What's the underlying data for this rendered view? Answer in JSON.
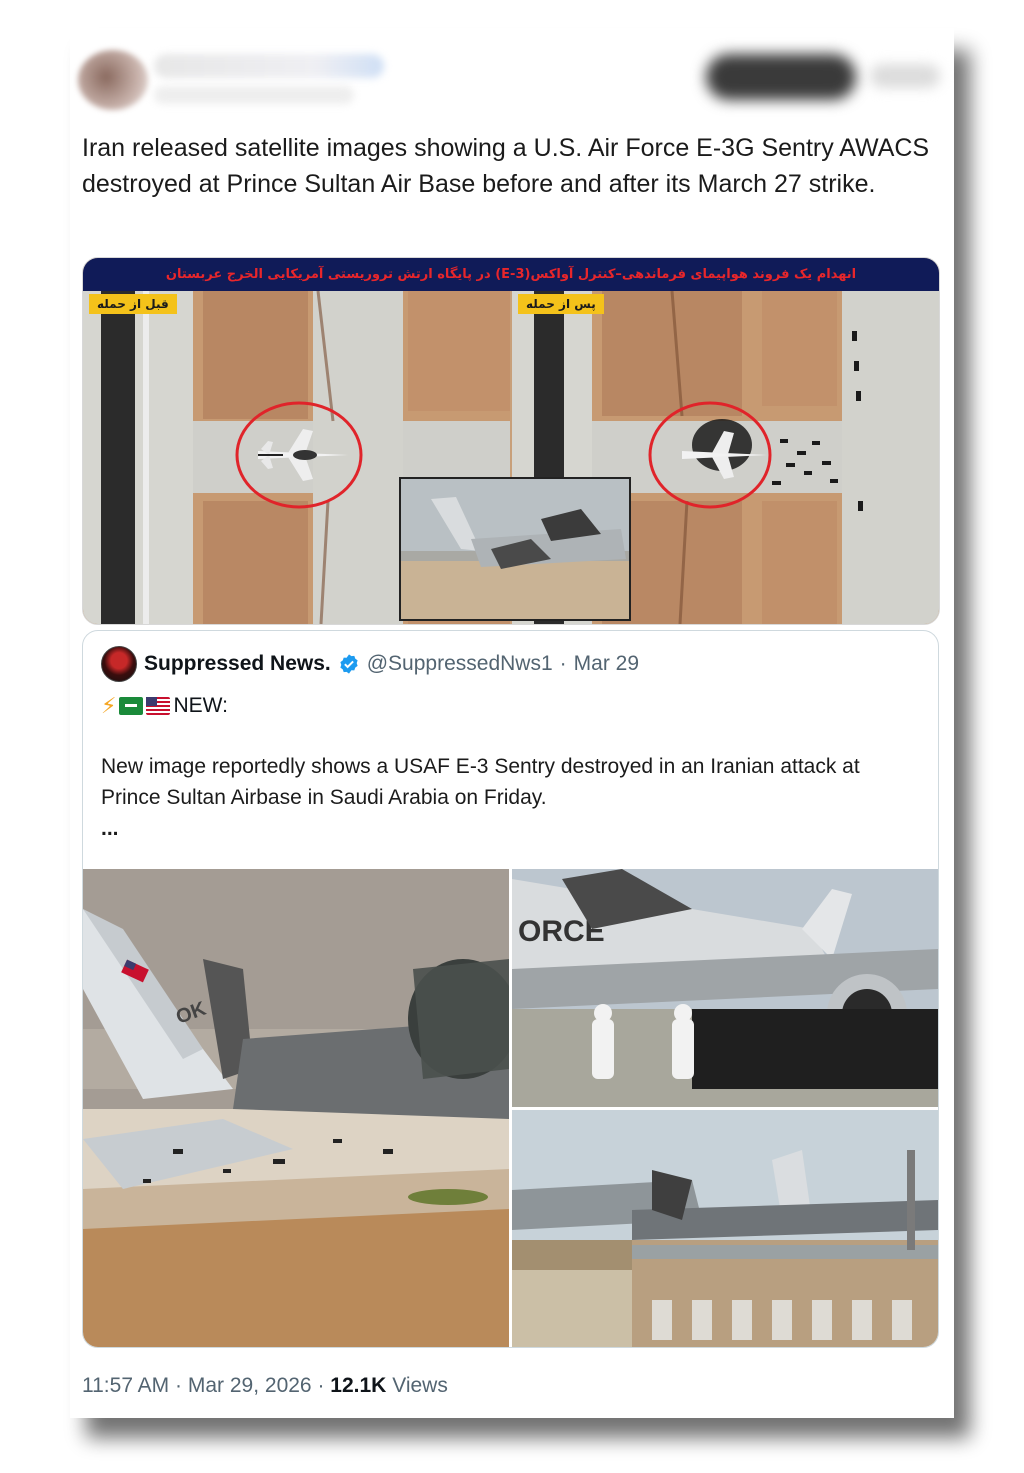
{
  "tweet": {
    "text": "Iran released satellite images showing a U.S. Air Force E-3G Sentry AWACS destroyed at Prince Sultan Air Base before and after its March 27 strike.",
    "media": {
      "banner_text": "انهدام یک فروند هواپیمای فرماندهی–کنترل آواکس(E-3) در پایگاه ارتش تروریستی آمریکایی الخرج عربستان",
      "before_label": "قبل از حمله",
      "after_label": "پس از حمله"
    }
  },
  "quoted": {
    "name": "Suppressed News.",
    "handle": "@SuppressedNws1",
    "separator": "·",
    "date": "Mar 29",
    "lead": "NEW:",
    "text": "New image reportedly shows a USAF E-3 Sentry destroyed in an Iranian attack at Prince Sultan Airbase in Saudi Arabia on Friday.",
    "ellipsis": "...",
    "photo_text": {
      "tail_code": "OK",
      "fuselage_text": "ORCE"
    }
  },
  "footer": {
    "time": "11:57 AM",
    "sep1": "·",
    "date": "Mar 29, 2026",
    "sep2": "·",
    "views_count": "12.1K",
    "views_label": "Views"
  },
  "colors": {
    "verified": "#1d9bf0",
    "banner_bg": "#101b58",
    "banner_text": "#e8262b",
    "tag_bg": "#f4c21a",
    "circle": "#e0242a"
  }
}
